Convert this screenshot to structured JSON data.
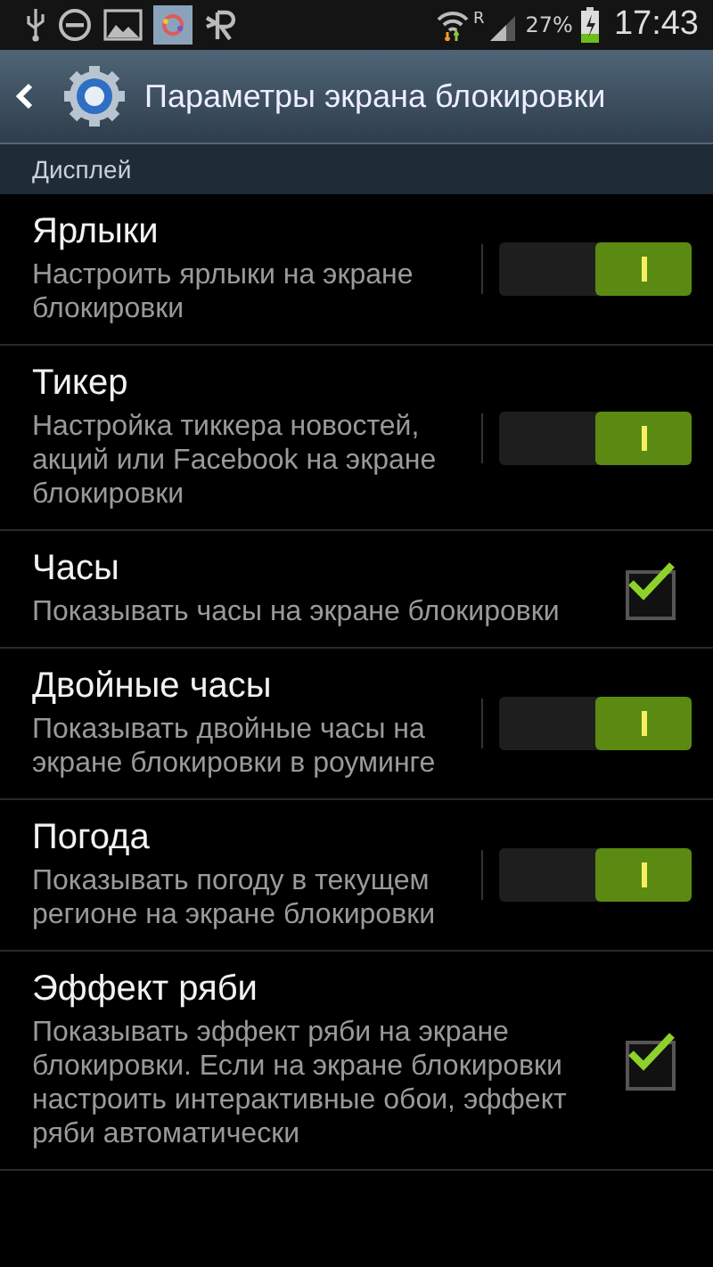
{
  "status_bar": {
    "roaming": "R",
    "battery": "27%",
    "time": "17:43"
  },
  "action_bar": {
    "title": "Параметры экрана блокировки"
  },
  "section": {
    "title": "Дисплей"
  },
  "items": [
    {
      "kind": "switch",
      "title": "Ярлыки",
      "description": "Настроить ярлыки на экране блокировки",
      "on": true
    },
    {
      "kind": "switch",
      "title": "Тикер",
      "description": "Настройка тиккера новостей, акций или Facebook на экране блокировки",
      "on": true
    },
    {
      "kind": "checkbox",
      "title": "Часы",
      "description": "Показывать часы на экране блокировки",
      "checked": true
    },
    {
      "kind": "switch",
      "title": "Двойные часы",
      "description": "Показывать двойные часы на экране блокировки в роуминге",
      "on": true
    },
    {
      "kind": "switch",
      "title": "Погода",
      "description": "Показывать погоду в текущем регионе на экране блокировки",
      "on": true
    },
    {
      "kind": "checkbox",
      "title": "Эффект ряби",
      "description": "Показывать эффект ряби на экране блокировки. Если на экране блокировки настроить интерактивные обои, эффект ряби автоматически",
      "checked": true
    }
  ]
}
